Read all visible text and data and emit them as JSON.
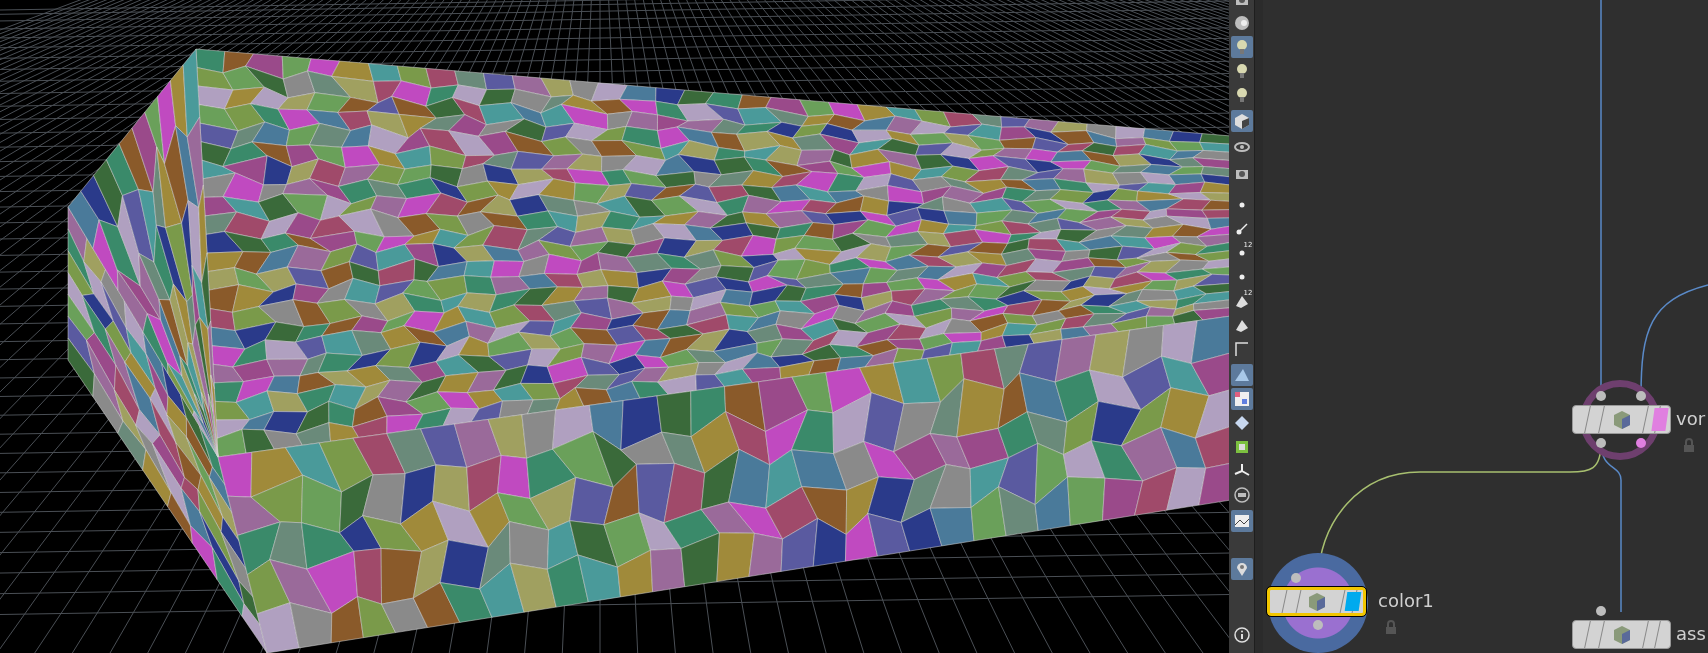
{
  "toolbar": [
    {
      "selected": false
    },
    {
      "selected": false
    },
    {
      "selected": true
    },
    {
      "selected": false
    },
    {
      "selected": false
    },
    {
      "selected": true
    },
    {
      "selected": false
    },
    {
      "selected": false
    },
    {
      "selected": false
    },
    {
      "selected": false
    },
    {
      "selected": false,
      "label": "12"
    },
    {
      "selected": false
    },
    {
      "selected": false,
      "label": "12"
    },
    {
      "selected": false
    },
    {
      "selected": false
    },
    {
      "selected": true
    },
    {
      "selected": true
    },
    {
      "selected": false
    },
    {
      "selected": false
    },
    {
      "selected": false
    },
    {
      "selected": false
    },
    {
      "selected": true
    },
    {
      "selected": true
    },
    {
      "selected": false
    }
  ],
  "network": {
    "nodes": [
      {
        "label": "vor",
        "selected": false,
        "color": "#e07fe0"
      },
      {
        "label": "color1",
        "selected": true,
        "color": "#00aaee"
      },
      {
        "label": "ass",
        "selected": false
      }
    ]
  }
}
